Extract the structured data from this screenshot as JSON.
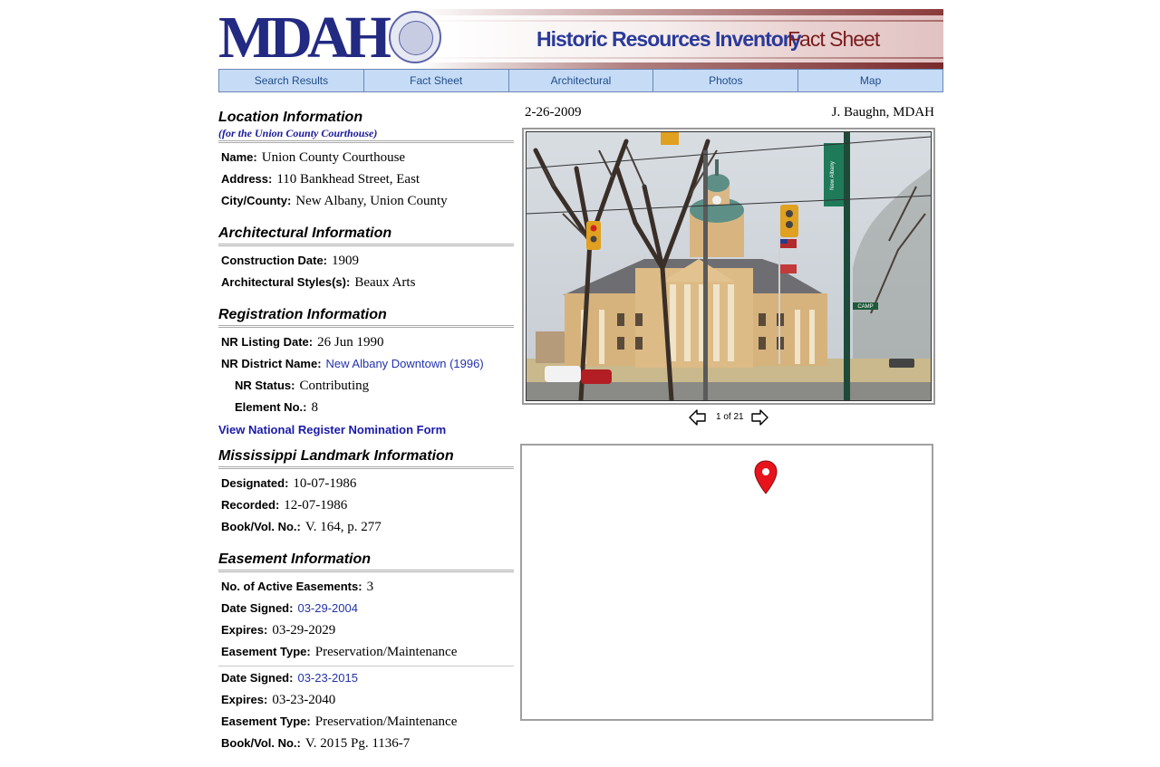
{
  "header": {
    "logo": "MDAH",
    "title": "Historic Resources Inventory",
    "subtitle": "Fact Sheet"
  },
  "nav": {
    "tabs": [
      "Search Results",
      "Fact Sheet",
      "Architectural",
      "Photos",
      "Map"
    ]
  },
  "location": {
    "title": "Location Information",
    "subtitle": "(for the Union County Courthouse)",
    "name_label": "Name:",
    "name": "Union County Courthouse",
    "address_label": "Address:",
    "address": "110 Bankhead Street, East",
    "city_label": "City/County:",
    "city": "New Albany, Union County"
  },
  "architectural": {
    "title": "Architectural Information",
    "date_label": "Construction Date:",
    "date": "1909",
    "styles_label": "Architectural Styles(s):",
    "styles": "Beaux Arts"
  },
  "registration": {
    "title": "Registration Information",
    "listing_label": "NR Listing Date:",
    "listing": "26 Jun 1990",
    "district_label": "NR District Name:",
    "district": "New Albany Downtown (1996)",
    "status_label": "NR Status:",
    "status": "Contributing",
    "element_label": "Element No.:",
    "element": "8",
    "form_link": "View National Register Nomination Form"
  },
  "landmark": {
    "title": "Mississippi Landmark Information",
    "designated_label": "Designated:",
    "designated": "10-07-1986",
    "recorded_label": "Recorded:",
    "recorded": "12-07-1986",
    "book_label": "Book/Vol. No.:",
    "book": "V. 164, p. 277"
  },
  "easement": {
    "title": "Easement Information",
    "active_label": "No. of Active Easements:",
    "active": "3",
    "items": [
      {
        "signed_label": "Date Signed:",
        "signed": "03-29-2004",
        "expires_label": "Expires:",
        "expires": "03-29-2029",
        "type_label": "Easement Type:",
        "type": "Preservation/Maintenance"
      },
      {
        "signed_label": "Date Signed:",
        "signed": "03-23-2015",
        "expires_label": "Expires:",
        "expires": "03-23-2040",
        "type_label": "Easement Type:",
        "type": "Preservation/Maintenance",
        "book_label": "Book/Vol. No.:",
        "book": "V. 2015 Pg. 1136-7"
      }
    ]
  },
  "photo": {
    "date": "2-26-2009",
    "credit": "J. Baughn, MDAH",
    "counter": "1 of 21",
    "sign_text": "New Albany",
    "street_sign": "CAMP"
  },
  "icons": {
    "prev": "left-arrow-icon",
    "next": "right-arrow-icon",
    "marker": "map-marker-icon",
    "seal": "state-seal-icon"
  },
  "colors": {
    "logo_blue": "#232a82",
    "title_blue": "#2a3a9a",
    "title_maroon": "#7a1c1c",
    "tab_bg": "#c6dbf6",
    "link_blue": "#2233aa",
    "pin_red": "#e8141b"
  }
}
